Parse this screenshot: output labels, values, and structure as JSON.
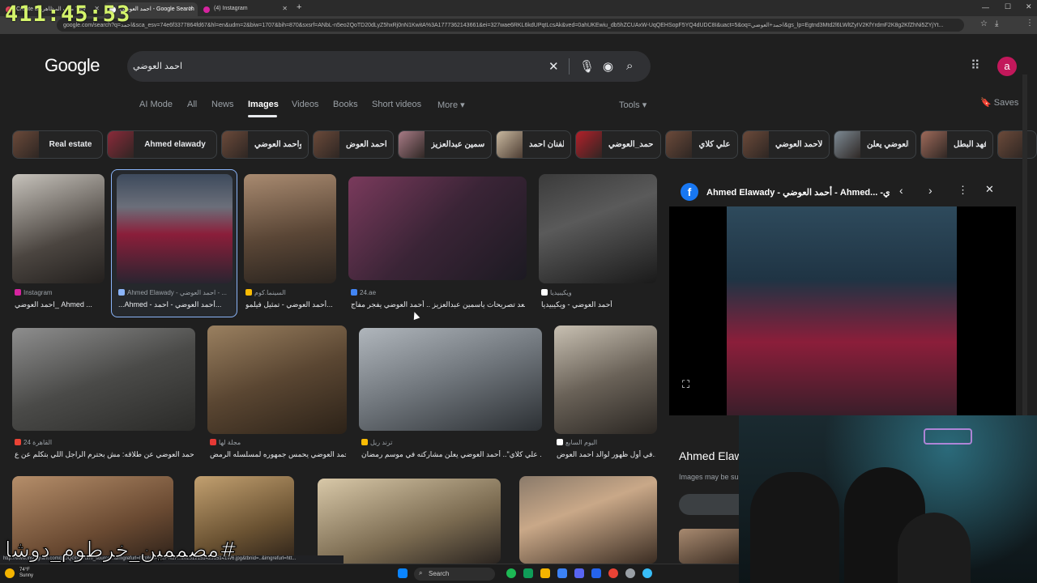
{
  "timer": "411:45:53",
  "browser": {
    "tabs": [
      {
        "label": "Create a ملف المظاهرو Tiev",
        "active": false
      },
      {
        "label": "احمد العوضي - Google Search",
        "active": true
      },
      {
        "label": "(4) Instagram",
        "active": false
      }
    ],
    "url": "google.com/search?q=احمد&sca_esv=74e6f3377864fd67&hl=en&udm=2&biw=1707&bih=870&sxsrf=ANbL-n5eo2QoTD20dLyZ5hxRj0nN1KwitA%3A1777362143661&ei=327wae6RKL6kdUPqtLcsAk&ved=0ahUKEwiu_db5hZCUAxW-UqQEHSopF5YQ4dUDC8I&uact=5&oq=احمد+العوضي&gs_lp=Egtnd3Mtd2l6LWltZyIV2KfYrdmF2K8g2KfZhNi5ZYjYt..."
  },
  "google": {
    "logo": "Google",
    "query": "احمد العوضي",
    "tabs": [
      "AI Mode",
      "All",
      "News",
      "Images",
      "Videos",
      "Books",
      "Short videos",
      "More"
    ],
    "tools": "Tools",
    "saves": "Saves",
    "avatar": "a"
  },
  "chips": [
    "Real estate",
    "Ahmed elawady",
    "واحمد العوضي",
    "احمد العوض",
    "ياسمين عبدالعزيز",
    "الفنان احمد",
    "احمد_العوضي",
    "علي كلاي",
    "لأحمد العوضي",
    "العوضي يعلن",
    "فهد البطل"
  ],
  "results": [
    {
      "source": "Instagram",
      "title": "احمد العوضي_ Ahmed ..."
    },
    {
      "source": "Ahmed Elawady - احمد العوضي - ...",
      "title": "...Ahmed - أحمد العوضي - احمد..."
    },
    {
      "source": "السينما.كوم",
      "title": "أحمد العوضي - تمثيل فيلمو..."
    },
    {
      "source": "24.ae",
      "title": "بعد تصريحات ياسمين عبدالعزيز .. أحمد العوضي يفجر مفاج..."
    },
    {
      "source": "ويكيبيديا",
      "title": "أحمد العوضي - ويكيبيديا"
    },
    {
      "source": "القاهرة 24",
      "title": "أحمد العوضي عن طلاقه: مش بحترم الراجل اللي بتكلم عن ع..."
    },
    {
      "source": "مجلة لها",
      "title": "أحمد العوضي يحمس جمهوره لمسلسله الرمض..."
    },
    {
      "source": "ترند ريل",
      "title": "علي كلاي\".. أحمد العوضي يعلن مشاركته في موسم رمضان ..."
    },
    {
      "source": "اليوم السابع",
      "title": "في أول ظهور لوالد احمد العوض..."
    }
  ],
  "panel": {
    "title": "Ahmed Elawady - أحمد العوضي - Ahmed... -ي",
    "name": "Ahmed Elawa",
    "note": "Images may be su"
  },
  "taskbar": {
    "search": "Search",
    "weather_temp": "74°F",
    "weather_desc": "Sunny"
  },
  "status_url": "http://www.instagram.com/p/DQGbd/?utm_source...&imgrefurl=http%3A%2F%2F...20251215142315141W6.jpg&tbnid=..&imgrefurl=htt...",
  "watermark": "#مصممين_خرطوم_دوشا"
}
